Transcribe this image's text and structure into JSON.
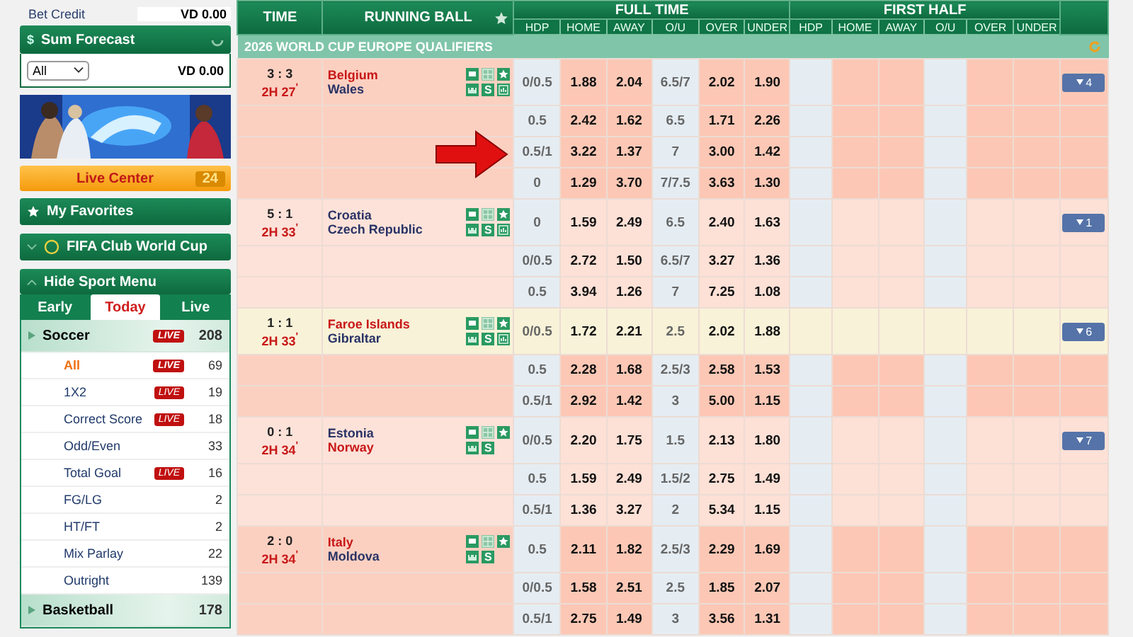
{
  "sidebar": {
    "bet_credit": {
      "label": "Bet Credit",
      "value": "VD 0.00"
    },
    "sum_forecast": {
      "glyph": "$",
      "title": "Sum Forecast",
      "select": "All",
      "value": "VD 0.00"
    },
    "live_center": {
      "label": "Live Center",
      "count": "24"
    },
    "favorites": "My Favorites",
    "club_cup": "FIFA Club World Cup",
    "hide_menu": "Hide Sport Menu",
    "tabs": [
      {
        "label": "Early",
        "selected": false
      },
      {
        "label": "Today",
        "selected": true
      },
      {
        "label": "Live",
        "selected": false
      }
    ],
    "sports": [
      {
        "name": "Soccer",
        "badge": "LIVE",
        "count": "208",
        "children": [
          {
            "label": "All",
            "badge": "LIVE",
            "count": "69",
            "selected": true
          },
          {
            "label": "1X2",
            "badge": "LIVE",
            "count": "19",
            "selected": false
          },
          {
            "label": "Correct Score",
            "badge": "LIVE",
            "count": "18",
            "selected": false
          },
          {
            "label": "Odd/Even",
            "count": "33",
            "selected": false
          },
          {
            "label": "Total Goal",
            "badge": "LIVE",
            "count": "16",
            "selected": false
          },
          {
            "label": "FG/LG",
            "count": "2",
            "selected": false
          },
          {
            "label": "HT/FT",
            "count": "2",
            "selected": false
          },
          {
            "label": "Mix Parlay",
            "count": "22",
            "selected": false
          },
          {
            "label": "Outright",
            "count": "139",
            "selected": false
          }
        ]
      },
      {
        "name": "Basketball",
        "count": "178"
      }
    ]
  },
  "table": {
    "time": "TIME",
    "running_ball": "RUNNING BALL",
    "full_time": "FULL TIME",
    "first_half": "FIRST HALF",
    "full_time_columns": [
      "HDP",
      "HOME",
      "AWAY",
      "O/U",
      "OVER",
      "UNDER"
    ],
    "first_half_columns": [
      "HDP",
      "HOME",
      "AWAY",
      "O/U",
      "OVER",
      "UNDER"
    ],
    "league": "2026 WORLD CUP EUROPE QUALIFIERS",
    "matches": [
      {
        "score": "3 : 3",
        "clock": "2H 27$^{'}$",
        "shaded": true,
        "highlighted": false,
        "more": "4",
        "teams": [
          {
            "name": "Belgium",
            "favorite": true
          },
          {
            "name": "Wales",
            "favorite": false
          }
        ],
        "icons": [
          {
            "kind": "tv"
          },
          {
            "kind": "pitch"
          },
          {
            "kind": "star"
          },
          {
            "kind": "stadium"
          },
          {
            "kind": "score",
            "glyph": "S"
          },
          {
            "kind": "stats"
          }
        ],
        "lines": [
          {
            "hdp": "0/0.5",
            "home": "1.88",
            "away": "2.04",
            "ou": "6.5/7",
            "over": "2.02",
            "under": "1.90"
          },
          {
            "hdp": "0.5",
            "home": "2.42",
            "away": "1.62",
            "ou": "6.5",
            "over": "1.71",
            "under": "2.26"
          },
          {
            "hdp": "0.5/1",
            "home": "3.22",
            "away": "1.37",
            "ou": "7",
            "over": "3.00",
            "under": "1.42"
          },
          {
            "hdp": "0",
            "home": "1.29",
            "away": "3.70",
            "ou": "7/7.5",
            "over": "3.63",
            "under": "1.30"
          }
        ]
      },
      {
        "score": "5 : 1",
        "clock": "2H 33$^{'}$",
        "shaded": false,
        "highlighted": false,
        "more": "1",
        "teams": [
          {
            "name": "Croatia",
            "favorite": false
          },
          {
            "name": "Czech Republic",
            "favorite": false
          }
        ],
        "icons": [
          {
            "kind": "tv"
          },
          {
            "kind": "pitch"
          },
          {
            "kind": "star"
          },
          {
            "kind": "stadium"
          },
          {
            "kind": "score",
            "glyph": "S"
          },
          {
            "kind": "stats"
          }
        ],
        "lines": [
          {
            "hdp": "0",
            "home": "1.59",
            "away": "2.49",
            "ou": "6.5",
            "over": "2.40",
            "under": "1.63"
          },
          {
            "hdp": "0/0.5",
            "home": "2.72",
            "away": "1.50",
            "ou": "6.5/7",
            "over": "3.27",
            "under": "1.36"
          },
          {
            "hdp": "0.5",
            "home": "3.94",
            "away": "1.26",
            "ou": "7",
            "over": "7.25",
            "under": "1.08"
          }
        ]
      },
      {
        "score": "1 : 1",
        "clock": "2H 33$^{'}$",
        "shaded": true,
        "highlighted": true,
        "more": "6",
        "teams": [
          {
            "name": "Faroe Islands",
            "favorite": true
          },
          {
            "name": "Gibraltar",
            "favorite": false
          }
        ],
        "icons": [
          {
            "kind": "tv"
          },
          {
            "kind": "pitch"
          },
          {
            "kind": "star"
          },
          {
            "kind": "stadium"
          },
          {
            "kind": "score",
            "glyph": "S"
          },
          {
            "kind": "stats"
          }
        ],
        "lines": [
          {
            "hdp": "0/0.5",
            "home": "1.72",
            "away": "2.21",
            "ou": "2.5",
            "over": "2.02",
            "under": "1.88"
          },
          {
            "hdp": "0.5",
            "home": "2.28",
            "away": "1.68",
            "ou": "2.5/3",
            "over": "2.58",
            "under": "1.53"
          },
          {
            "hdp": "0.5/1",
            "home": "2.92",
            "away": "1.42",
            "ou": "3",
            "over": "5.00",
            "under": "1.15"
          }
        ]
      },
      {
        "score": "0 : 1",
        "clock": "2H 34$^{'}$",
        "shaded": false,
        "highlighted": false,
        "more": "7",
        "teams": [
          {
            "name": "Estonia",
            "favorite": false
          },
          {
            "name": "Norway",
            "favorite": true
          }
        ],
        "icons": [
          {
            "kind": "tv"
          },
          {
            "kind": "pitch"
          },
          {
            "kind": "star"
          },
          {
            "kind": "stadium"
          },
          {
            "kind": "score",
            "glyph": "S"
          }
        ],
        "lines": [
          {
            "hdp": "0/0.5",
            "home": "2.20",
            "away": "1.75",
            "ou": "1.5",
            "over": "2.13",
            "under": "1.80"
          },
          {
            "hdp": "0.5",
            "home": "1.59",
            "away": "2.49",
            "ou": "1.5/2",
            "over": "2.75",
            "under": "1.49"
          },
          {
            "hdp": "0.5/1",
            "home": "1.36",
            "away": "3.27",
            "ou": "2",
            "over": "5.34",
            "under": "1.15"
          }
        ]
      },
      {
        "score": "2 : 0",
        "clock": "2H 34$^{'}$",
        "shaded": true,
        "highlighted": false,
        "teams": [
          {
            "name": "Italy",
            "favorite": true
          },
          {
            "name": "Moldova",
            "favorite": false
          }
        ],
        "icons": [
          {
            "kind": "tv"
          },
          {
            "kind": "pitch"
          },
          {
            "kind": "star"
          },
          {
            "kind": "stadium"
          },
          {
            "kind": "score",
            "glyph": "S"
          }
        ],
        "lines": [
          {
            "hdp": "0.5",
            "home": "2.11",
            "away": "1.82",
            "ou": "2.5/3",
            "over": "2.29",
            "under": "1.69"
          },
          {
            "hdp": "0/0.5",
            "home": "1.58",
            "away": "2.51",
            "ou": "2.5",
            "over": "1.85",
            "under": "2.07"
          },
          {
            "hdp": "0.5/1",
            "home": "2.75",
            "away": "1.49",
            "ou": "3",
            "over": "3.56",
            "under": "1.31"
          }
        ]
      }
    ]
  }
}
